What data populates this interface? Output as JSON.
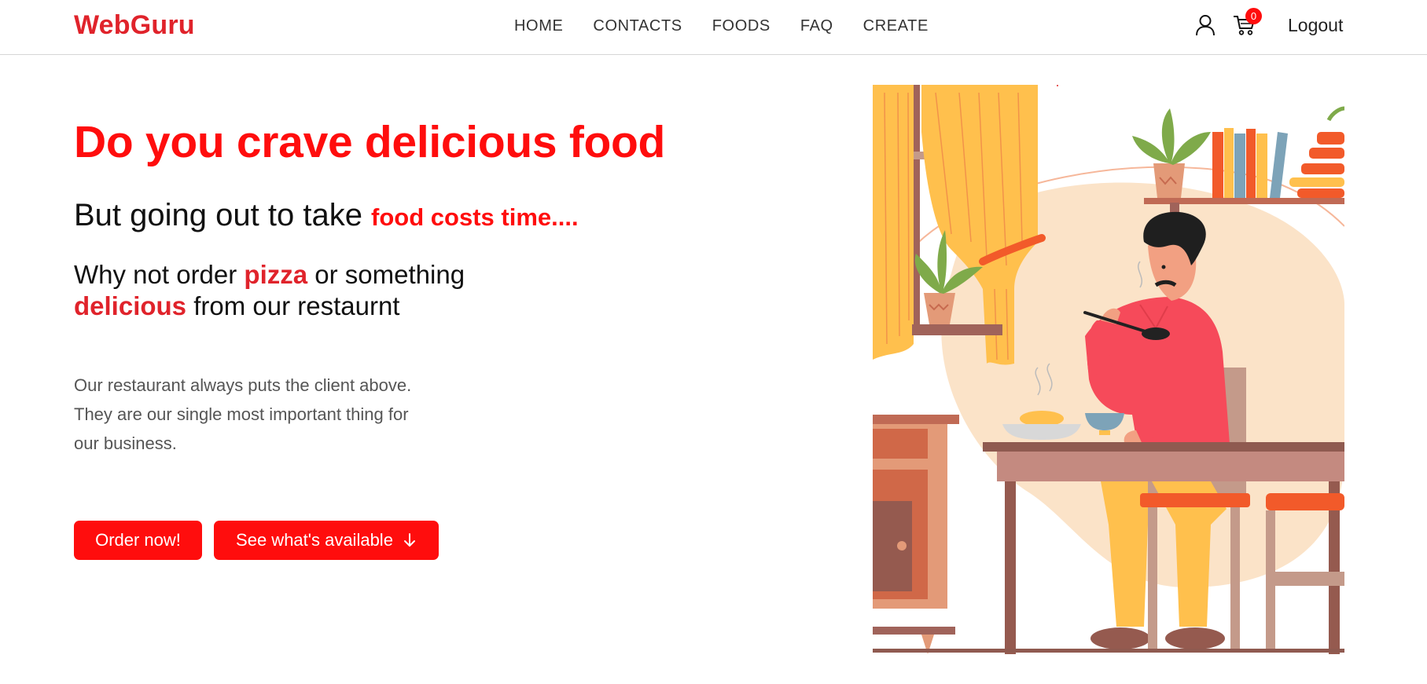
{
  "brand": "WebGuru",
  "nav": {
    "links": [
      "HOME",
      "CONTACTS",
      "FOODS",
      "FAQ",
      "CREATE"
    ],
    "cart_count": "0",
    "logout": "Logout",
    "icons": [
      "user-icon",
      "cart-icon"
    ]
  },
  "hero": {
    "title": "Do you crave delicious food",
    "subtitle_plain": "But going out to take ",
    "subtitle_accent": "food costs time....",
    "line1_a": "Why not order ",
    "line1_accent": "pizza",
    "line1_b": " or something",
    "line2_accent": "delicious",
    "line2_b": " from our restaurnt",
    "description": "Our restaurant always puts the client above. They are our single most important thing for our business.",
    "order_button": "Order now!",
    "see_button": "See what's available",
    "see_button_icon": "arrow-down-icon"
  },
  "colors": {
    "brand": "#e0232b",
    "accent": "#ff0d0d"
  }
}
